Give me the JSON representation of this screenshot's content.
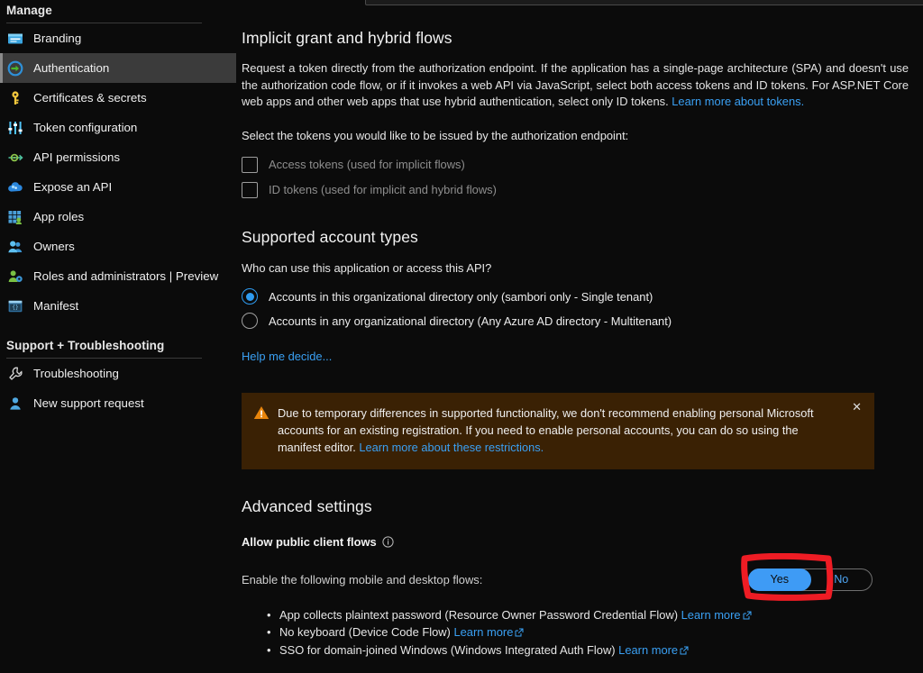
{
  "sidebar": {
    "sections": [
      {
        "title": "Manage",
        "items": [
          {
            "label": "Branding",
            "icon": "branding-icon",
            "selected": false
          },
          {
            "label": "Authentication",
            "icon": "authentication-icon",
            "selected": true
          },
          {
            "label": "Certificates & secrets",
            "icon": "key-icon",
            "selected": false
          },
          {
            "label": "Token configuration",
            "icon": "sliders-icon",
            "selected": false
          },
          {
            "label": "API permissions",
            "icon": "api-permissions-icon",
            "selected": false
          },
          {
            "label": "Expose an API",
            "icon": "cloud-icon",
            "selected": false
          },
          {
            "label": "App roles",
            "icon": "app-roles-icon",
            "selected": false
          },
          {
            "label": "Owners",
            "icon": "owners-icon",
            "selected": false
          },
          {
            "label": "Roles and administrators | Preview",
            "icon": "roles-admins-icon",
            "selected": false
          },
          {
            "label": "Manifest",
            "icon": "manifest-icon",
            "selected": false
          }
        ]
      },
      {
        "title": "Support + Troubleshooting",
        "items": [
          {
            "label": "Troubleshooting",
            "icon": "wrench-icon",
            "selected": false
          },
          {
            "label": "New support request",
            "icon": "support-person-icon",
            "selected": false
          }
        ]
      }
    ]
  },
  "main": {
    "implicit": {
      "heading": "Implicit grant and hybrid flows",
      "description": "Request a token directly from the authorization endpoint. If the application has a single-page architecture (SPA) and doesn't use the authorization code flow, or if it invokes a web API via JavaScript, select both access tokens and ID tokens. For ASP.NET Core web apps and other web apps that use hybrid authentication, select only ID tokens. ",
      "description_link": "Learn more about tokens.",
      "select_prompt": "Select the tokens you would like to be issued by the authorization endpoint:",
      "checkboxes": [
        {
          "label": "Access tokens (used for implicit flows)",
          "checked": false
        },
        {
          "label": "ID tokens (used for implicit and hybrid flows)",
          "checked": false
        }
      ]
    },
    "account_types": {
      "heading": "Supported account types",
      "question": "Who can use this application or access this API?",
      "options": [
        {
          "label": "Accounts in this organizational directory only (sambori only - Single tenant)",
          "selected": true
        },
        {
          "label": "Accounts in any organizational directory (Any Azure AD directory - Multitenant)",
          "selected": false
        }
      ],
      "help_link": "Help me decide..."
    },
    "banner": {
      "icon": "warning-icon",
      "text": "Due to temporary differences in supported functionality, we don't recommend enabling personal Microsoft accounts for an existing registration. If you need to enable personal accounts, you can do so using the manifest editor. ",
      "link": "Learn more about these restrictions.",
      "close": "✕",
      "background": "#3a2104"
    },
    "advanced": {
      "heading": "Advanced settings",
      "public_client_label": "Allow public client flows",
      "info_icon": "info-icon",
      "enable_text": "Enable the following mobile and desktop flows:",
      "toggle": {
        "yes_label": "Yes",
        "no_label": "No",
        "value": "Yes",
        "accent": "#3e9bf5"
      },
      "flows": [
        {
          "text": "App collects plaintext password (Resource Owner Password Credential Flow)",
          "link": "Learn more"
        },
        {
          "text": "No keyboard (Device Code Flow)",
          "link": "Learn more"
        },
        {
          "text": "SSO for domain-joined Windows (Windows Integrated Auth Flow)",
          "link": "Learn more"
        }
      ]
    }
  },
  "annotation": {
    "shape": "hand-drawn-rectangle",
    "color": "#ee1c24",
    "target": "allow-public-client-flows-toggle-yes"
  }
}
